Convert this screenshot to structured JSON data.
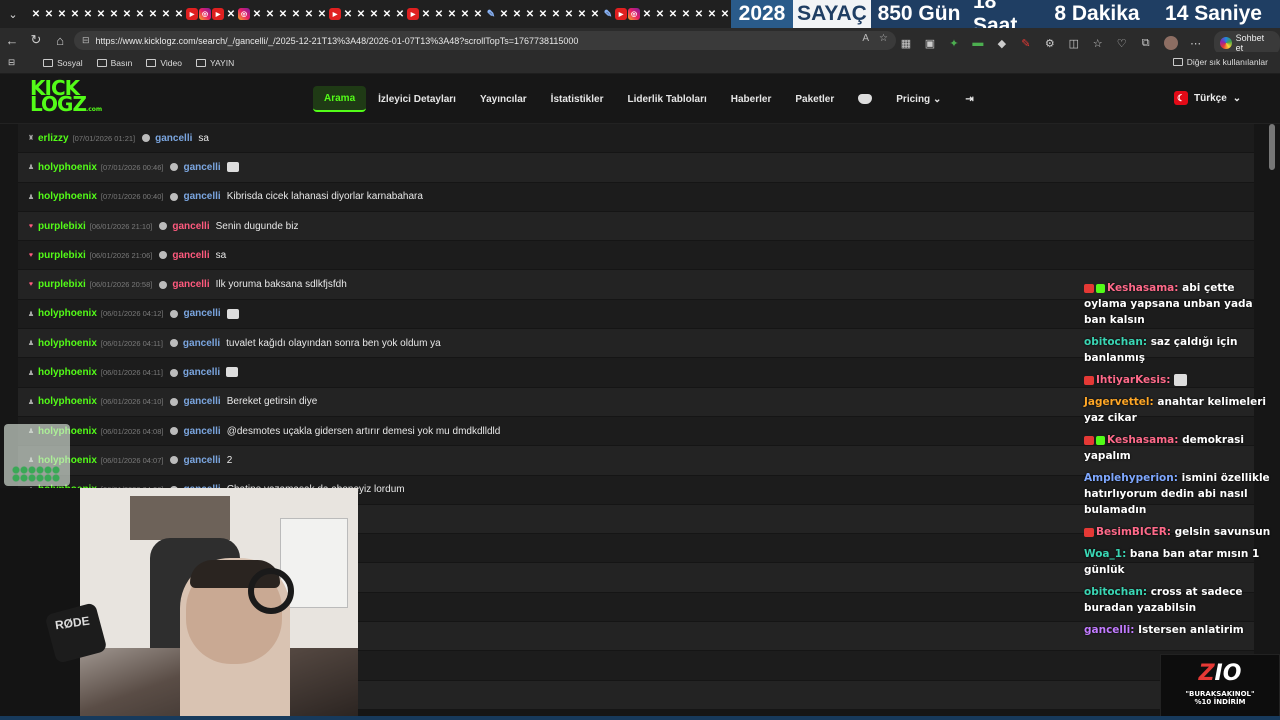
{
  "browser": {
    "url": "https://www.kicklogz.com/search/_/gancelli/_/2025-12-21T13%3A48/2026-01-07T13%3A48?scrollTopTs=1767738115000",
    "copilot_label": "Sohbet et",
    "bookmarks": [
      "Sosyal",
      "Basın",
      "Video",
      "YAYIN"
    ],
    "other_bookmarks": "Diğer sık kullanılanlar"
  },
  "counter": {
    "year": "2028",
    "label": "SAYAÇ",
    "days": "850 Gün",
    "hours": "18 Saat",
    "minutes": "8  Dakika",
    "seconds": "14 Saniye"
  },
  "site": {
    "logo_top": "KICK",
    "logo_bottom": "LOGZ",
    "logo_suffix": ".com",
    "menu": [
      "Arama",
      "İzleyici Detayları",
      "Yayıncılar",
      "İstatistikler",
      "Liderlik Tabloları",
      "Haberler",
      "Paketler"
    ],
    "pricing": "Pricing",
    "language": "Türkçe"
  },
  "chat_rows": [
    {
      "user": "erlizzy",
      "ts": "[07/01/2026 01:21]",
      "target": "gancelli",
      "target_color": "blue",
      "msg": "sa"
    },
    {
      "user": "holyphoenix",
      "ts": "[07/01/2026 00:46]",
      "target": "gancelli",
      "target_color": "blue",
      "msg": ""
    },
    {
      "user": "holyphoenix",
      "ts": "[07/01/2026 00:40]",
      "target": "gancelli",
      "target_color": "blue",
      "msg": "Kibrisda cicek lahanasi diyorlar karnabahara"
    },
    {
      "user": "purplebixi",
      "ts": "[06/01/2026 21:10]",
      "target": "gancelli",
      "target_color": "pink",
      "msg": "Senin dugunde biz"
    },
    {
      "user": "purplebixi",
      "ts": "[06/01/2026 21:06]",
      "target": "gancelli",
      "target_color": "pink",
      "msg": "sa"
    },
    {
      "user": "purplebixi",
      "ts": "[06/01/2026 20:58]",
      "target": "gancelli",
      "target_color": "pink",
      "msg": "Ilk yoruma baksana sdlkfjsfdh"
    },
    {
      "user": "holyphoenix",
      "ts": "[06/01/2026 04:12]",
      "target": "gancelli",
      "target_color": "blue",
      "msg": ""
    },
    {
      "user": "holyphoenix",
      "ts": "[06/01/2026 04:11]",
      "target": "gancelli",
      "target_color": "blue",
      "msg": "tuvalet kağıdı olayından sonra ben yok oldum ya"
    },
    {
      "user": "holyphoenix",
      "ts": "[06/01/2026 04:11]",
      "target": "gancelli",
      "target_color": "blue",
      "msg": ""
    },
    {
      "user": "holyphoenix",
      "ts": "[06/01/2026 04:10]",
      "target": "gancelli",
      "target_color": "blue",
      "msg": "Bereket getirsin diye"
    },
    {
      "user": "holyphoenix",
      "ts": "[06/01/2026 04:08]",
      "target": "gancelli",
      "target_color": "blue",
      "msg": "@desmotes uçakla gidersen artırır demesi yok mu dmdkdlldld"
    },
    {
      "user": "holyphoenix",
      "ts": "[06/01/2026 04:07]",
      "target": "gancelli",
      "target_color": "blue",
      "msg": "2"
    },
    {
      "user": "holyphoenix",
      "ts": "[06/01/2026 04:06]",
      "target": "gancelli",
      "target_color": "blue",
      "msg": "Chatine yazamasak da aboneyiz lordum"
    }
  ],
  "overlay_chat": [
    {
      "name": "Keshasama:",
      "color": "pink",
      "text": "abi çette oylama yapsana unban yada ban kalsın"
    },
    {
      "name": "obitochan:",
      "color": "teal",
      "text": "saz çaldığı için banlanmış"
    },
    {
      "name": "IhtiyarKesis:",
      "color": "pink",
      "text": ""
    },
    {
      "name": "Jagervettel:",
      "color": "orange",
      "text": "anahtar kelimeleri yaz cikar"
    },
    {
      "name": "Keshasama:",
      "color": "pink",
      "text": "demokrasi yapalım"
    },
    {
      "name": "Amplehyperion:",
      "color": "blue",
      "text": "ismini özellikle hatırlıyorum dedin abi nasıl bulamadın"
    },
    {
      "name": "BesimBICER:",
      "color": "pink",
      "text": "gelsin savunsun"
    },
    {
      "name": "Woa_1:",
      "color": "teal",
      "text": "bana ban atar mısın 1 günlük"
    },
    {
      "name": "obitochan:",
      "color": "teal",
      "text": "cross at sadece buradan yazabilsin"
    },
    {
      "name": "gancelli:",
      "color": "purple",
      "text": "Istersen anlatirim"
    }
  ],
  "webcam": {
    "mic_brand": "RØDE"
  },
  "sponsor": {
    "logo": "Z",
    "logo_accent": "IO",
    "code": "\"BURAKSAKINOL\"",
    "discount": "%10 İNDİRİM"
  }
}
